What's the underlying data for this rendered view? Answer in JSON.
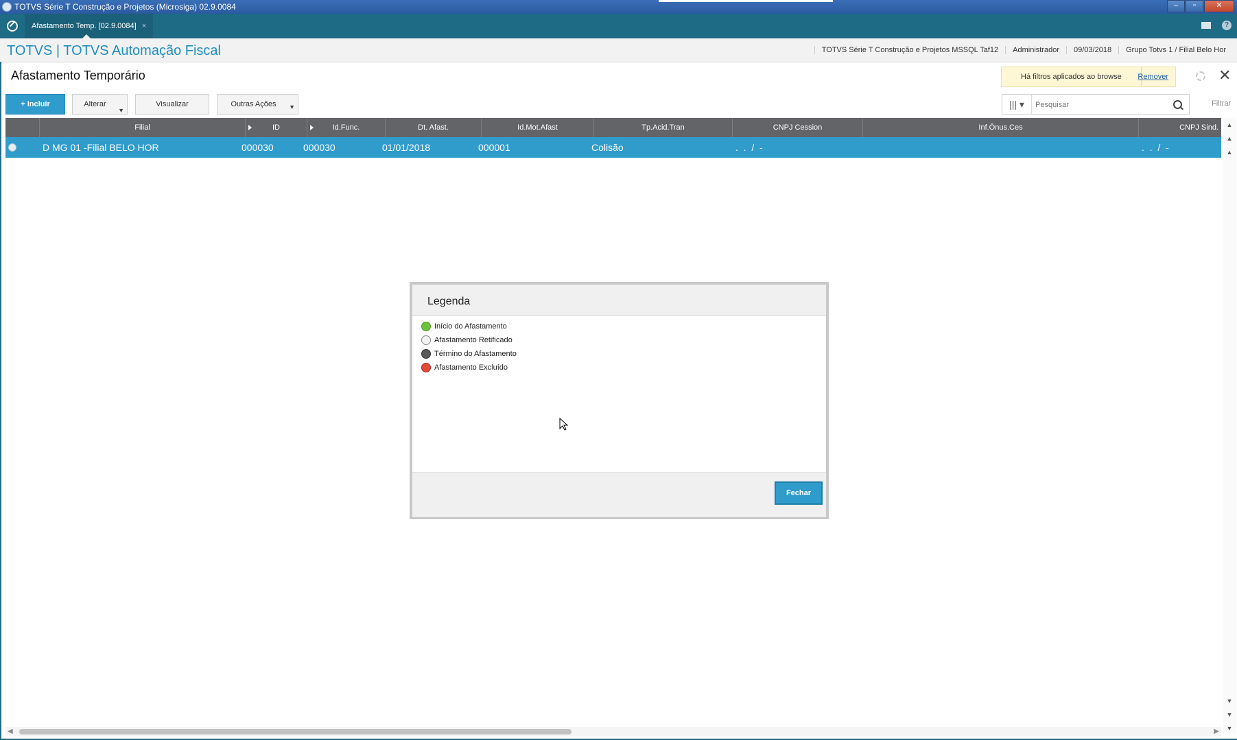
{
  "window": {
    "title": "TOTVS Série T Construção e Projetos (Microsiga) 02.9.0084",
    "min_glyph": "–",
    "max_glyph": "▫",
    "close_glyph": "✕"
  },
  "tabbar": {
    "tab_label": "Afastamento Temp. [02.9.0084]",
    "tab_close": "×",
    "help_glyph": "?"
  },
  "header": {
    "brand": "TOTVS | TOTVS Automação Fiscal",
    "environment": "TOTVS Série T Construção e Projetos MSSQL Taf12",
    "user": "Administrador",
    "date": "09/03/2018",
    "branch": "Grupo Totvs 1 / Filial Belo Hor"
  },
  "page": {
    "title": "Afastamento Temporário",
    "close_glyph": "✕"
  },
  "filter_notice": {
    "message": "Há filtros aplicados ao browse",
    "remove_label": "Remover"
  },
  "toolbar": {
    "include_label": "+ Incluir",
    "alter_label": "Alterar",
    "view_label": "Visualizar",
    "other_label": "Outras Ações",
    "caret": "▼",
    "cols_glyph": "|||  ▾",
    "search_placeholder": "Pesquisar",
    "filter_label": "Filtrar"
  },
  "grid": {
    "columns": [
      "Filial",
      "ID",
      "Id.Func.",
      "Dt. Afast.",
      "Id.Mot.Afast",
      "Tp.Acid.Tran",
      "CNPJ Cession",
      "Inf.Ônus.Ces",
      "CNPJ Sind."
    ],
    "rows": [
      {
        "filial": "D MG 01 -Filial BELO HOR",
        "id": "000030",
        "id_func": "000030",
        "dt_afast": "01/01/2018",
        "id_mot_afast": "000001",
        "tp_acid_tran": "Colisão",
        "cnpj_cession": ".  .  /  -",
        "inf_onus_ces": "",
        "cnpj_sind": ".  .  /  -"
      }
    ]
  },
  "scroll": {
    "up": "▲",
    "down": "▼",
    "left": "◀",
    "right": "▶"
  },
  "modal": {
    "title": "Legenda",
    "items": [
      {
        "label": "Início do Afastamento",
        "color": "#6dc23a"
      },
      {
        "label": "Afastamento Retificado",
        "color": "#f2f2f2"
      },
      {
        "label": "Término do Afastamento",
        "color": "#5a5a5a"
      },
      {
        "label": "Afastamento Excluído",
        "color": "#e04a3a"
      }
    ],
    "close_label": "Fechar"
  },
  "colors": {
    "accent": "#2f9ccc",
    "tabbar": "#1e6b86",
    "grid_header": "#626468"
  }
}
